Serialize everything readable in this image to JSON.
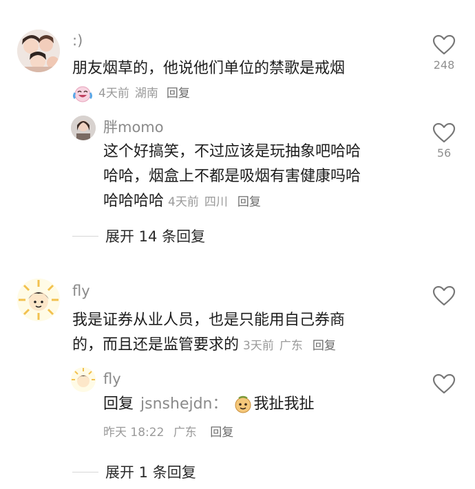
{
  "comments": [
    {
      "author": ":)",
      "text": "朋友烟草的，他说他们单位的禁歌是戒烟",
      "time": "4天前",
      "location": "湖南",
      "reply_label": "回复",
      "likes": "248",
      "replies": [
        {
          "author": "胖momo",
          "text_lines": [
            "这个好搞笑，不过应该是玩抽象吧哈哈",
            "哈哈，烟盒上不都是吸烟有害健康吗哈",
            "哈哈哈哈"
          ],
          "time": "4天前",
          "location": "四川",
          "reply_label": "回复",
          "likes": "56"
        }
      ],
      "expand_label": "展开 14 条回复"
    },
    {
      "author": "fly",
      "text_lines": [
        "我是证券从业人员，也是只能用自己券商",
        "的，而且还是监管要求的"
      ],
      "time": "3天前",
      "location": "广东",
      "reply_label": "回复",
      "replies": [
        {
          "author": "fly",
          "reply_prefix": "回复",
          "reply_to": "jsnshejdn：",
          "text": "我扯我扯",
          "time": "昨天 18:22",
          "location": "广东",
          "reply_label": "回复"
        }
      ],
      "expand_label": "展开 1 条回复"
    }
  ],
  "colors": {
    "heart": "#777777",
    "meta": "#9a9a9a",
    "name": "#8a8a8a"
  },
  "icons": {
    "like": "heart-outline-icon",
    "emoji": "crying-laughing-emoji"
  }
}
